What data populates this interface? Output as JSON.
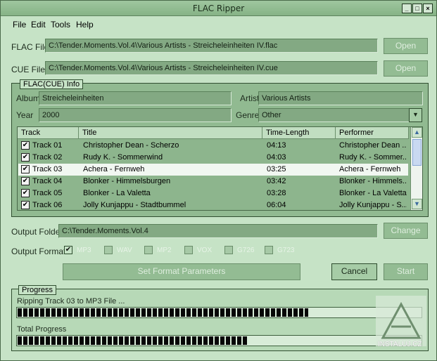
{
  "window": {
    "title": "FLAC Ripper"
  },
  "menu": [
    "File",
    "Edit",
    "Tools",
    "Help"
  ],
  "flac_file": {
    "label": "FLAC File",
    "value": "C:\\Tender.Moments.Vol.4\\Various Artists - Streicheleinheiten IV.flac",
    "button": "Open"
  },
  "cue_file": {
    "label": "CUE File",
    "value": "C:\\Tender.Moments.Vol.4\\Various Artists - Streicheleinheiten IV.cue",
    "button": "Open"
  },
  "info": {
    "title": "FLAC(CUE) Info",
    "album_label": "Album",
    "album": "Streicheleinheiten",
    "artist_label": "Artist",
    "artist": "Various Artists",
    "year_label": "Year",
    "year": "2000",
    "genre_label": "Genre",
    "genre": "Other"
  },
  "tracks": {
    "headers": [
      "Track",
      "Title",
      "Time-Length",
      "Performer"
    ],
    "rows": [
      {
        "track": "Track 01",
        "title": "Christopher Dean - Scherzo",
        "length": "04:13",
        "performer": "Christopher Dean ..."
      },
      {
        "track": "Track 02",
        "title": "Rudy K. - Sommerwind",
        "length": "04:03",
        "performer": "Rudy K. - Sommer..."
      },
      {
        "track": "Track 03",
        "title": "Achera - Fernweh",
        "length": "03:25",
        "performer": "Achera - Fernweh"
      },
      {
        "track": "Track 04",
        "title": "Blonker - Himmelsburgen",
        "length": "03:42",
        "performer": "Blonker - Himmels..."
      },
      {
        "track": "Track 05",
        "title": "Blonker - La Valetta",
        "length": "03:28",
        "performer": "Blonker - La Valetta"
      },
      {
        "track": "Track 06",
        "title": "Jolly Kunjappu - Stadtbummel",
        "length": "06:04",
        "performer": "Jolly Kunjappu - S..."
      }
    ],
    "selected_index": 2
  },
  "output": {
    "folder_label": "Output Folder",
    "folder": "C:\\Tender.Moments.Vol.4",
    "change_button": "Change",
    "format_label": "Output Format:",
    "formats": [
      "MP3",
      "WAV",
      "MP2",
      "VOX",
      "G726",
      "G723"
    ],
    "checked_format": "MP3",
    "set_params_button": "Set Format Parameters",
    "cancel_button": "Cancel",
    "start_button": "Start"
  },
  "progress": {
    "title": "Progress",
    "current_label": "Ripping Track 03 to MP3 File ...",
    "current_fraction": 0.72,
    "total_label": "Total Progress",
    "total_fraction": 0.57
  },
  "watermark": "INSTALUJ.CZ"
}
